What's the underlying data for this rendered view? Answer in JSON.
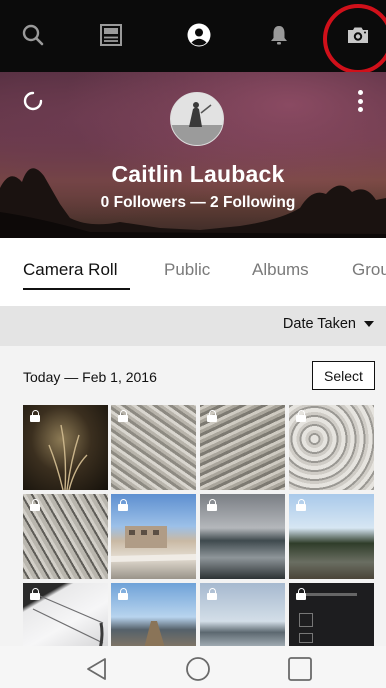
{
  "topbar": {
    "icons": [
      "search-icon",
      "feed-icon",
      "profile-icon",
      "notifications-icon",
      "camera-icon"
    ],
    "active": "profile-icon",
    "highlight_color": "#d0101a"
  },
  "profile": {
    "name": "Caitlin Lauback",
    "follow_summary": "0 Followers — 2 Following"
  },
  "tabs": [
    {
      "label": "Camera Roll",
      "active": true
    },
    {
      "label": "Public",
      "active": false
    },
    {
      "label": "Albums",
      "active": false
    },
    {
      "label": "Groups",
      "active": false
    }
  ],
  "sort": {
    "label": "Date Taken"
  },
  "section": {
    "date": "Today — Feb 1, 2016",
    "select_label": "Select"
  },
  "photos": [
    {
      "subject": "dry grass",
      "locked": true
    },
    {
      "subject": "shells",
      "locked": true
    },
    {
      "subject": "shells",
      "locked": true
    },
    {
      "subject": "rope",
      "locked": true
    },
    {
      "subject": "oyster shells",
      "locked": true
    },
    {
      "subject": "building",
      "locked": true
    },
    {
      "subject": "water",
      "locked": true
    },
    {
      "subject": "shoreline",
      "locked": true
    },
    {
      "subject": "sail",
      "locked": true
    },
    {
      "subject": "pier",
      "locked": true
    },
    {
      "subject": "water",
      "locked": true
    },
    {
      "subject": "screen",
      "locked": true
    }
  ],
  "system_nav": [
    "back-icon",
    "home-icon",
    "recents-icon"
  ]
}
